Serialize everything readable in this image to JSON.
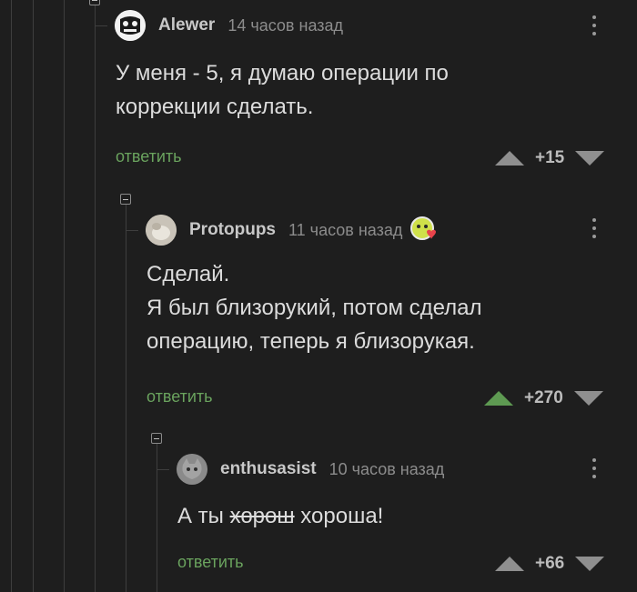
{
  "comments": [
    {
      "author": "Alewer",
      "time": "14 часов назад",
      "lines": [
        "У меня - 5, я думаю операции по",
        "коррекции сделать."
      ],
      "reply_label": "ответить",
      "score": "+15",
      "upvoted": false
    },
    {
      "author": "Protopups",
      "time": "11 часов назад",
      "lines": [
        "Сделай.",
        "Я был близорукий, потом сделал",
        "операцию, теперь я близорукая."
      ],
      "reply_label": "ответить",
      "score": "+270",
      "upvoted": true
    },
    {
      "author": "enthusasist",
      "time": "10 часов назад",
      "text_before": "А ты ",
      "text_struck": "хорош",
      "text_after": " хороша!",
      "reply_label": "ответить",
      "score": "+66",
      "upvoted": false
    }
  ],
  "colors": {
    "background": "#1e1e1e",
    "reply": "#6aa35e",
    "upvote_active": "#5e9a52"
  }
}
